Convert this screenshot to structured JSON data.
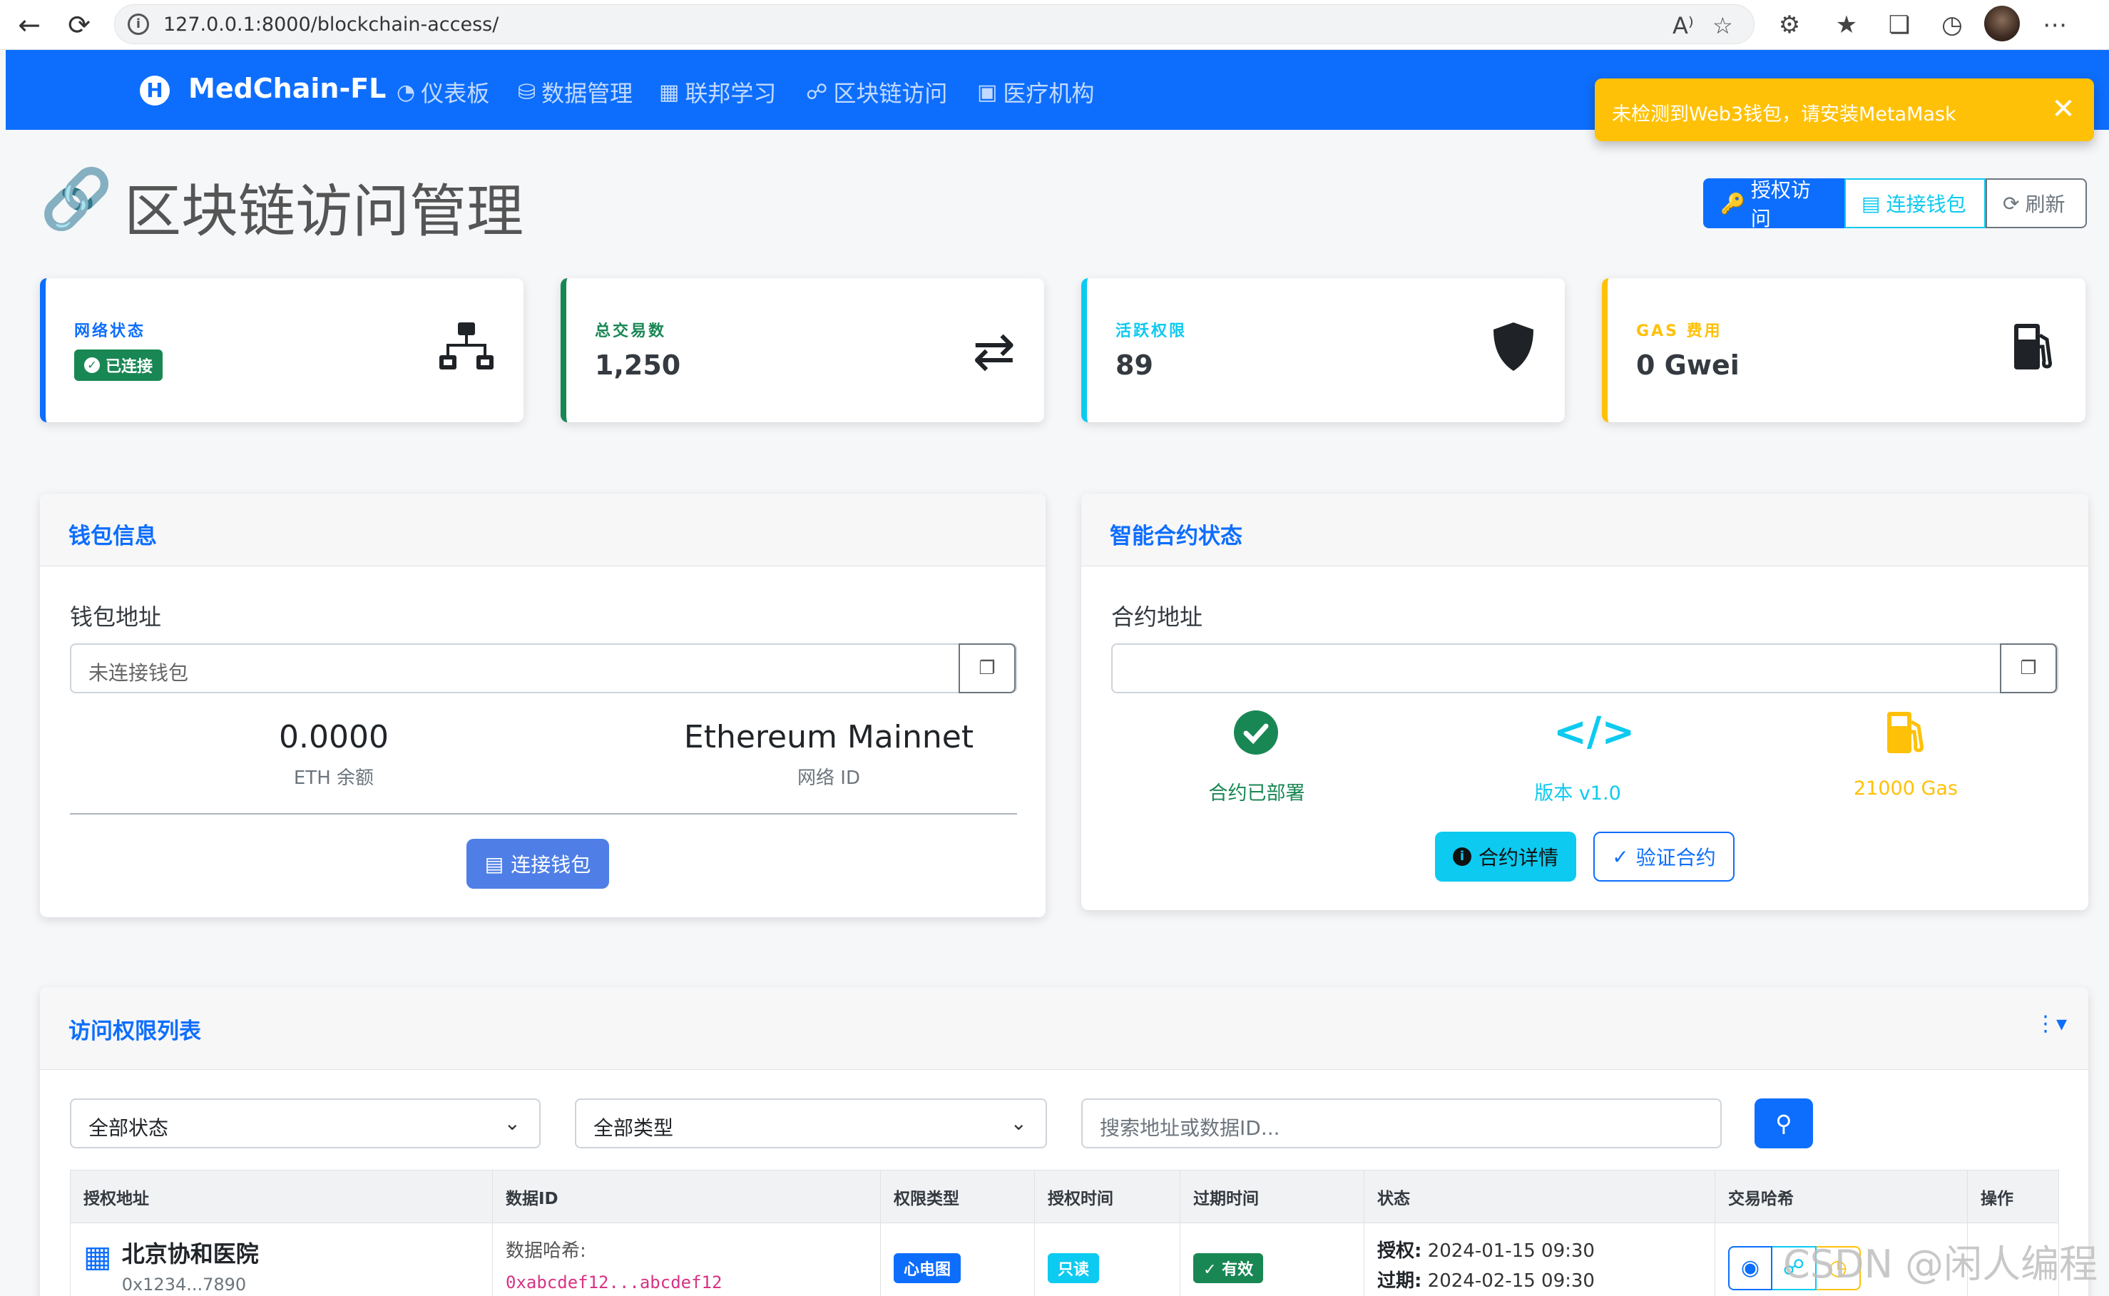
{
  "browser": {
    "url": "127.0.0.1:8000/blockchain-access/",
    "back_icon": "arrow-left-icon",
    "reload_icon": "reload-icon",
    "read_aloud": "A⁾",
    "right_icons": [
      "read-aloud-icon",
      "favorite-icon",
      "extensions-icon",
      "favorites-icon",
      "collections-icon",
      "history-icon",
      "profile-avatar",
      "more-icon"
    ]
  },
  "navbar": {
    "brand_initial": "H",
    "brand": "MedChain-FL",
    "links": [
      {
        "label": "仪表板",
        "icon": "dashboard-icon"
      },
      {
        "label": "数据管理",
        "icon": "database-icon"
      },
      {
        "label": "联邦学习",
        "icon": "network-icon"
      },
      {
        "label": "区块链访问",
        "icon": "link-icon"
      },
      {
        "label": "医疗机构",
        "icon": "hospital-icon"
      }
    ],
    "color": "#0d6efd"
  },
  "toast": {
    "text": "未检测到Web3钱包，请安装MetaMask",
    "color": "#ffc107"
  },
  "page": {
    "title": "区块链访问管理",
    "buttons": {
      "authorize": "授权访问",
      "connect_wallet": "连接钱包",
      "refresh": "刷新"
    }
  },
  "stats": [
    {
      "label": "网络状态",
      "badge": "已连接",
      "color": "#0d6efd",
      "icon": "sitemap-icon"
    },
    {
      "label": "总交易数",
      "value": "1,250",
      "color": "#198754",
      "icon": "exchange-icon"
    },
    {
      "label": "活跃权限",
      "value": "89",
      "color": "#0dcaf0",
      "icon": "shield-icon"
    },
    {
      "label": "GAS 费用",
      "value": "0 Gwei",
      "color": "#ffc107",
      "icon": "gas-pump-icon"
    }
  ],
  "wallet": {
    "title": "钱包信息",
    "address_label": "钱包地址",
    "address_value": "未连接钱包",
    "balance": "0.0000",
    "balance_label": "ETH 余额",
    "network": "Ethereum Mainnet",
    "network_label": "网络 ID",
    "connect_button": "连接钱包"
  },
  "contract": {
    "title": "智能合约状态",
    "address_label": "合约地址",
    "address_value": "",
    "deployed": "合约已部署",
    "version": "版本 v1.0",
    "gas": "21000 Gas",
    "details_button": "合约详情",
    "verify_button": "验证合约"
  },
  "access_list": {
    "title": "访问权限列表",
    "status_filter": "全部状态",
    "type_filter": "全部类型",
    "search_placeholder": "搜索地址或数据ID...",
    "columns": [
      "授权地址",
      "数据ID",
      "权限类型",
      "授权时间",
      "过期时间",
      "状态",
      "交易哈希",
      "操作"
    ],
    "rows": [
      {
        "institution": "北京协和医院",
        "address": "0x1234...7890",
        "data_label": "数据哈希:",
        "data_hash": "0xabcdef12...abcdef12",
        "type": "心电图",
        "permission": "只读",
        "status": "有效",
        "granted_label": "授权:",
        "granted": "2024-01-15 09:30",
        "expires_label": "过期:",
        "expires": "2024-02-15 09:30"
      }
    ]
  },
  "watermark": "CSDN @闲人编程"
}
